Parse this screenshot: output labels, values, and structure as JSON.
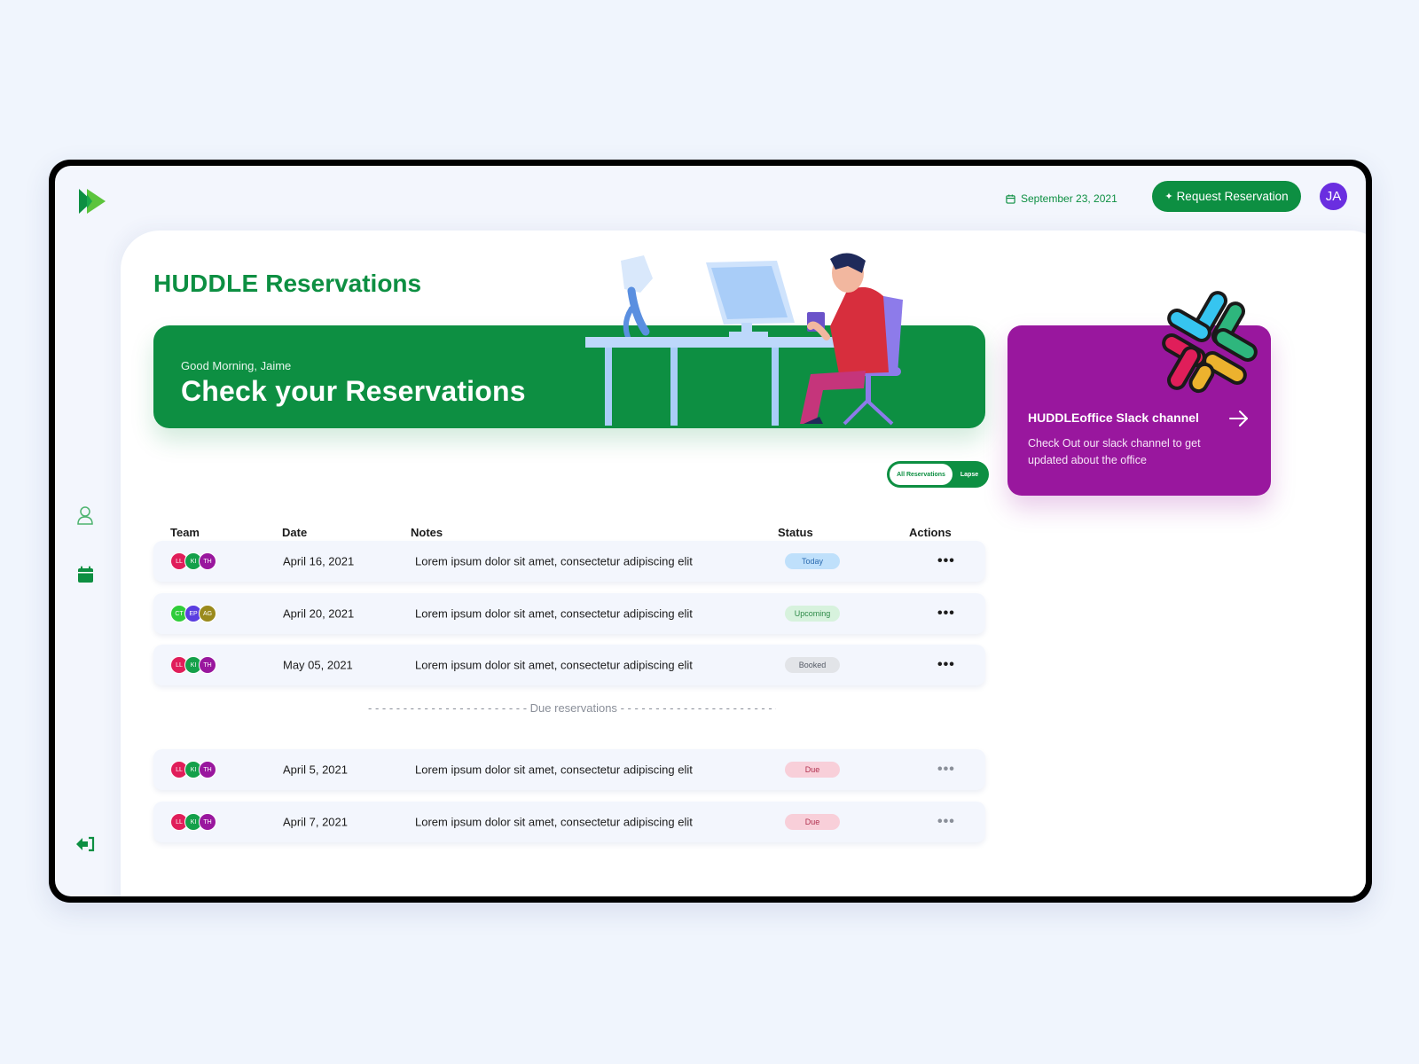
{
  "topbar": {
    "date": "September 23, 2021",
    "request_button": "Request Reservation",
    "user_initials": "JA"
  },
  "page": {
    "title_bold": "HUDDLE",
    "title_rest": "Reservations"
  },
  "hero": {
    "greeting": "Good Morning, Jaime",
    "title": "Check your Reservations"
  },
  "slack": {
    "title": "HUDDLEoffice Slack channel",
    "description": "Check Out our slack channel to get updated about the office"
  },
  "filter": {
    "active": "All Reservations",
    "inactive": "Lapse"
  },
  "table": {
    "headers": {
      "team": "Team",
      "date": "Date",
      "notes": "Notes",
      "status": "Status",
      "actions": "Actions"
    },
    "rows": [
      {
        "team": [
          "LL",
          "KI",
          "TH"
        ],
        "date": "April 16, 2021",
        "notes": "Lorem ipsum dolor sit amet, consectetur adipiscing elit",
        "status": "Today"
      },
      {
        "team": [
          "CT",
          "EP",
          "AG"
        ],
        "date": "April 20, 2021",
        "notes": "Lorem ipsum dolor sit amet, consectetur adipiscing elit",
        "status": "Upcoming"
      },
      {
        "team": [
          "LL",
          "KI",
          "TH"
        ],
        "date": "May 05, 2021",
        "notes": "Lorem ipsum dolor sit amet, consectetur adipiscing elit",
        "status": "Booked"
      }
    ],
    "due_label": "Due reservations",
    "due_rows": [
      {
        "team": [
          "LL",
          "KI",
          "TH"
        ],
        "date": "April 5, 2021",
        "notes": "Lorem ipsum dolor sit amet, consectetur adipiscing elit",
        "status": "Due"
      },
      {
        "team": [
          "LL",
          "KI",
          "TH"
        ],
        "date": "April 7, 2021",
        "notes": "Lorem ipsum dolor sit amet, consectetur adipiscing elit",
        "status": "Due"
      }
    ]
  },
  "colors": {
    "brand_green": "#0d8f42",
    "slack_purple": "#99179e",
    "avatar_purple": "#6a2ee0",
    "status_today": "#bfe0fb",
    "status_upcoming": "#d7f2dd",
    "status_booked": "#e2e4e8",
    "status_due": "#f8cfd9"
  },
  "icons": {
    "logo": "play-logo-icon",
    "date": "calendar-icon",
    "profile": "user-icon",
    "reservations": "calendar-icon",
    "logout": "sign-out-icon",
    "slack": "slack-logo-icon",
    "arrow": "arrow-right-icon",
    "actions": "more-dots-icon"
  }
}
